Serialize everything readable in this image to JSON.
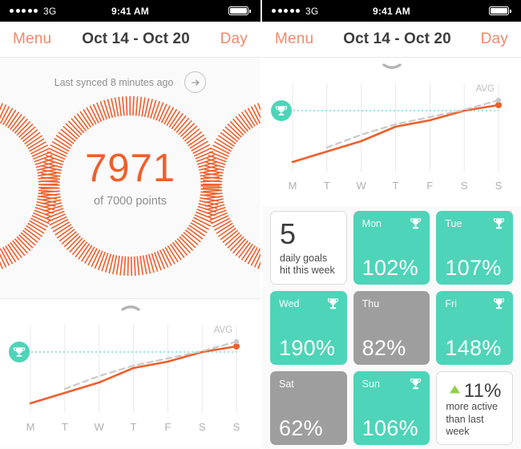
{
  "accent_orange": "#ef5f2c",
  "accent_teal": "#4ed4b8",
  "accent_gray": "#9e9e9e",
  "accent_green": "#8fd148",
  "status_bar": {
    "carrier": "3G",
    "signal_dots": 5,
    "time": "9:41 AM",
    "battery_icon": "battery-full-icon"
  },
  "navbar": {
    "menu_label": "Menu",
    "title": "Oct 14 - Oct 20",
    "day_label": "Day"
  },
  "left_screen": {
    "sync": {
      "text": "Last synced 8 minutes ago",
      "arrow_icon": "arrow-right-icon"
    },
    "dial": {
      "points": "7971",
      "goal_text": "of 7000 points"
    },
    "handle_icon": "chevron-up-icon"
  },
  "right_screen": {
    "handle_icon": "chevron-down-icon",
    "goals_tile": {
      "count": "5",
      "label": "daily goals\nhit this week"
    },
    "days": [
      {
        "day": "Mon",
        "value": "102%",
        "goal_met": true,
        "trophy_icon": "trophy-icon"
      },
      {
        "day": "Tue",
        "value": "107%",
        "goal_met": true,
        "trophy_icon": "trophy-icon"
      },
      {
        "day": "Wed",
        "value": "190%",
        "goal_met": true,
        "trophy_icon": "trophy-icon"
      },
      {
        "day": "Thu",
        "value": "82%",
        "goal_met": false,
        "trophy_icon": ""
      },
      {
        "day": "Fri",
        "value": "148%",
        "goal_met": true,
        "trophy_icon": "trophy-icon"
      },
      {
        "day": "Sat",
        "value": "62%",
        "goal_met": false,
        "trophy_icon": ""
      },
      {
        "day": "Sun",
        "value": "106%",
        "goal_met": true,
        "trophy_icon": "trophy-icon"
      }
    ],
    "delta_tile": {
      "arrow_icon": "triangle-up-icon",
      "value": "11%",
      "label": "more active\nthan last\nweek"
    }
  },
  "chart_data": {
    "type": "line",
    "title": "",
    "xlabel": "",
    "ylabel": "",
    "categories": [
      "M",
      "T",
      "W",
      "T",
      "F",
      "S",
      "S"
    ],
    "tick_labels": [
      "M",
      "T",
      "W",
      "T",
      "F",
      "S",
      "S"
    ],
    "grid": true,
    "legend_position": "inline-right",
    "annotations": [
      {
        "text": "AVG",
        "target": "average-series",
        "position": "top-right"
      },
      {
        "text": "trophy-badge",
        "target": "goal-line",
        "position": "left"
      }
    ],
    "goal_line": {
      "label": "goal",
      "value": 72,
      "style": "dotted",
      "color": "#7fdcd0"
    },
    "ylim": [
      0,
      100
    ],
    "series": [
      {
        "name": "Points",
        "color": "#ef5f2c",
        "style": "solid",
        "values": [
          8,
          21,
          34,
          52,
          60,
          72,
          79
        ],
        "end_marker": true
      },
      {
        "name": "AVG",
        "color": "#c9c9c9",
        "style": "dashed",
        "values": [
          null,
          26,
          42,
          55,
          64,
          73,
          85
        ],
        "end_marker": true
      }
    ]
  }
}
